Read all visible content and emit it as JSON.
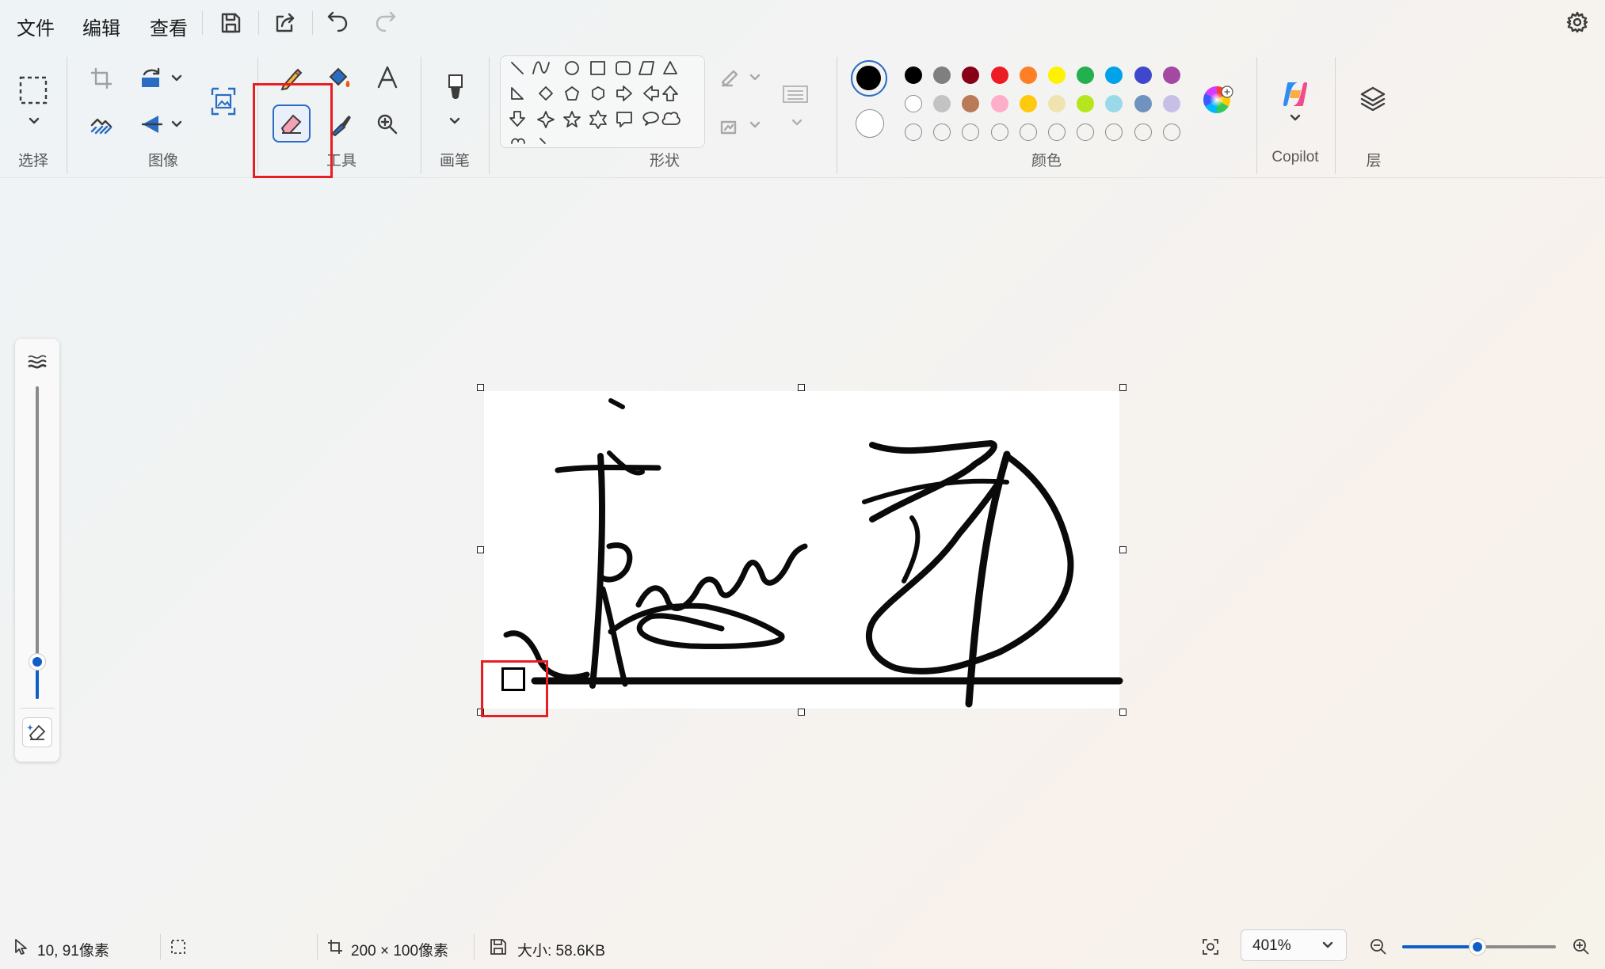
{
  "menu": {
    "file": "文件",
    "edit": "编辑",
    "view": "查看"
  },
  "ribbon": {
    "groups": {
      "select": "选择",
      "image": "图像",
      "tools": "工具",
      "brushes": "画笔",
      "shapes": "形状",
      "colors": "颜色",
      "copilot": "Copilot",
      "layers": "层"
    },
    "selected_tool": "eraser",
    "palette": {
      "row1": [
        "#000000",
        "#7f7f7f",
        "#880015",
        "#ed1c24",
        "#ff7f27",
        "#fff200",
        "#22b14c",
        "#00a2e8",
        "#3f48cc",
        "#a349a4"
      ],
      "row2": [
        "#ffffff",
        "#c3c3c3",
        "#b97a57",
        "#ffaec9",
        "#ffc90e",
        "#efe4b0",
        "#b5e61d",
        "#99d9ea",
        "#7092be",
        "#c8bfe7"
      ],
      "row3_empty_slots": 10,
      "primary_color": "#000000",
      "secondary_color": "#ffffff"
    }
  },
  "status": {
    "cursor_position": "10, 91像素",
    "canvas_size": "200 × 100像素",
    "file_size": "大小: 58.6KB",
    "zoom": "401%",
    "zoom_slider_fraction": 0.49
  },
  "brush_size_slider_fraction": 0.12
}
